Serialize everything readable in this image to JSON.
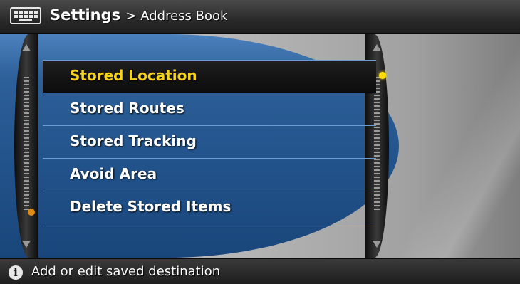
{
  "header": {
    "icon": "keyboard-icon",
    "title": "Settings",
    "breadcrumb": "> Address Book"
  },
  "menu": {
    "items": [
      {
        "label": "Stored Location",
        "selected": true
      },
      {
        "label": "Stored Routes",
        "selected": false
      },
      {
        "label": "Stored Tracking",
        "selected": false
      },
      {
        "label": "Avoid Area",
        "selected": false
      },
      {
        "label": "Delete Stored Items",
        "selected": false
      }
    ]
  },
  "footer": {
    "icon": "info-icon",
    "info_glyph": "i",
    "text": "Add or edit saved destination"
  },
  "colors": {
    "selected_text": "#f5d21e",
    "menu_blue": "#2d5f98",
    "indicator_yellow": "#ffe000",
    "indicator_orange": "#e08a10"
  }
}
